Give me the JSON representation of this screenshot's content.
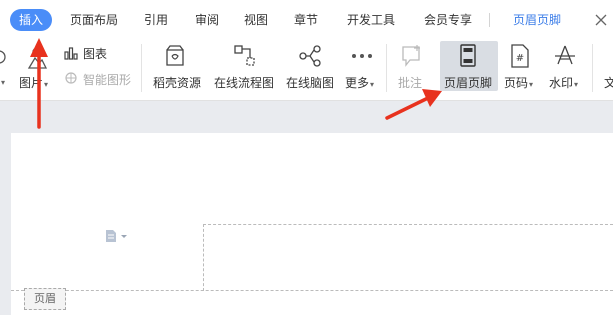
{
  "tabs": [
    {
      "label": "插入",
      "active": true
    },
    {
      "label": "页面布局"
    },
    {
      "label": "引用"
    },
    {
      "label": "审阅"
    },
    {
      "label": "视图"
    },
    {
      "label": "章节"
    },
    {
      "label": "开发工具"
    },
    {
      "label": "会员专享"
    },
    {
      "label": "页眉页脚",
      "accent": true
    }
  ],
  "ribbon": {
    "chart_label": "图表",
    "picture_label": "图片",
    "smart_shape_label": "智能图形",
    "resources_label": "稻壳资源",
    "flowchart_label": "在线流程图",
    "mindmap_label": "在线脑图",
    "more_label": "更多",
    "comment_label": "批注",
    "header_footer_label": "页眉页脚",
    "page_number_label": "页码",
    "watermark_label": "水印",
    "text_label_partial": "文"
  },
  "document": {
    "header_label": "页眉"
  },
  "colors": {
    "accent": "#4a8df8",
    "arrow": "#e8321e"
  }
}
